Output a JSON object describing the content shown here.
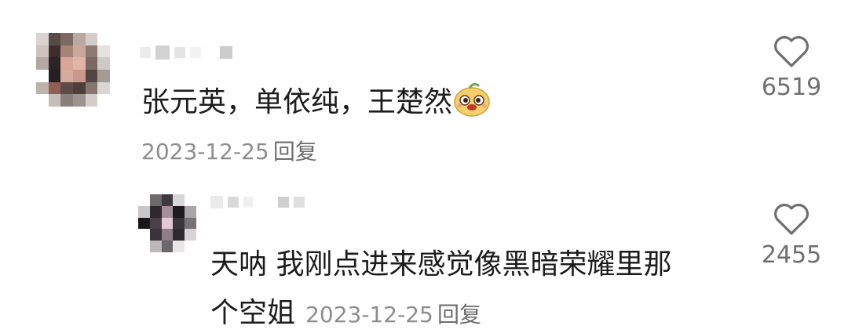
{
  "comments": [
    {
      "text": "张元英，单依纯，王楚然",
      "emoji": "bee-face-emoji",
      "date": "2023-12-25",
      "reply_label": "回复",
      "likes": "6519"
    }
  ],
  "replies": [
    {
      "text_line1": "天呐 我刚点进来感觉像黑暗荣耀里那",
      "text_line2": "个空姐",
      "date": "2023-12-25",
      "reply_label": "回复",
      "likes": "2455"
    }
  ],
  "icons": {
    "like": "heart-outline-icon"
  },
  "colors": {
    "text": "#1c1c1c",
    "meta": "#8d8d8d",
    "icon": "#6f6f6f"
  }
}
